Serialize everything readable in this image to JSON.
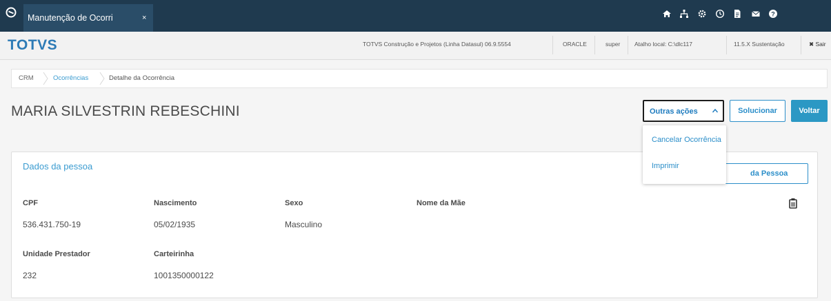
{
  "topbar": {
    "tab_title": "Manutenção de Ocorri",
    "tab_close": "×",
    "icons": [
      "home-icon",
      "sitemap-icon",
      "settings-icon",
      "clock-icon",
      "document-icon",
      "mail-icon",
      "help-icon"
    ]
  },
  "header": {
    "brand": "TOTVS",
    "product": "TOTVS Construção e Projetos (Linha Datasul) 06.9.5554",
    "database": "ORACLE",
    "user": "super",
    "shortcut": "Atalho local: C:\\dlc117",
    "version": "11.5.X Sustentação",
    "logout": "✖ Sair"
  },
  "breadcrumb": {
    "items": [
      "CRM",
      "Ocorrências",
      "Detalhe da Ocorrência"
    ]
  },
  "page": {
    "person_name": "MARIA SILVESTRIN REBESCHINI"
  },
  "actions": {
    "outras_acoes": "Outras ações",
    "solucionar": "Solucionar",
    "voltar": "Voltar"
  },
  "dropdown": {
    "items": [
      "Cancelar Ocorrência",
      "Imprimir"
    ]
  },
  "card": {
    "title": "Dados da pessoa",
    "pessoa_button": "da Pessoa",
    "fields": {
      "cpf": {
        "label": "CPF",
        "value": "536.431.750-19"
      },
      "nascimento": {
        "label": "Nascimento",
        "value": "05/02/1935"
      },
      "sexo": {
        "label": "Sexo",
        "value": "Masculino"
      },
      "nome_mae": {
        "label": "Nome da Mãe",
        "value": ""
      },
      "unidade": {
        "label": "Unidade Prestador",
        "value": "232"
      },
      "carteirinha": {
        "label": "Carteirinha",
        "value": "1001350000122"
      }
    }
  },
  "colors": {
    "topbar": "#1f3a4f",
    "tab": "#2a4d68",
    "brand": "#2d7bb6",
    "accent": "#2b8ec9",
    "primary_button": "#2b98c4"
  }
}
